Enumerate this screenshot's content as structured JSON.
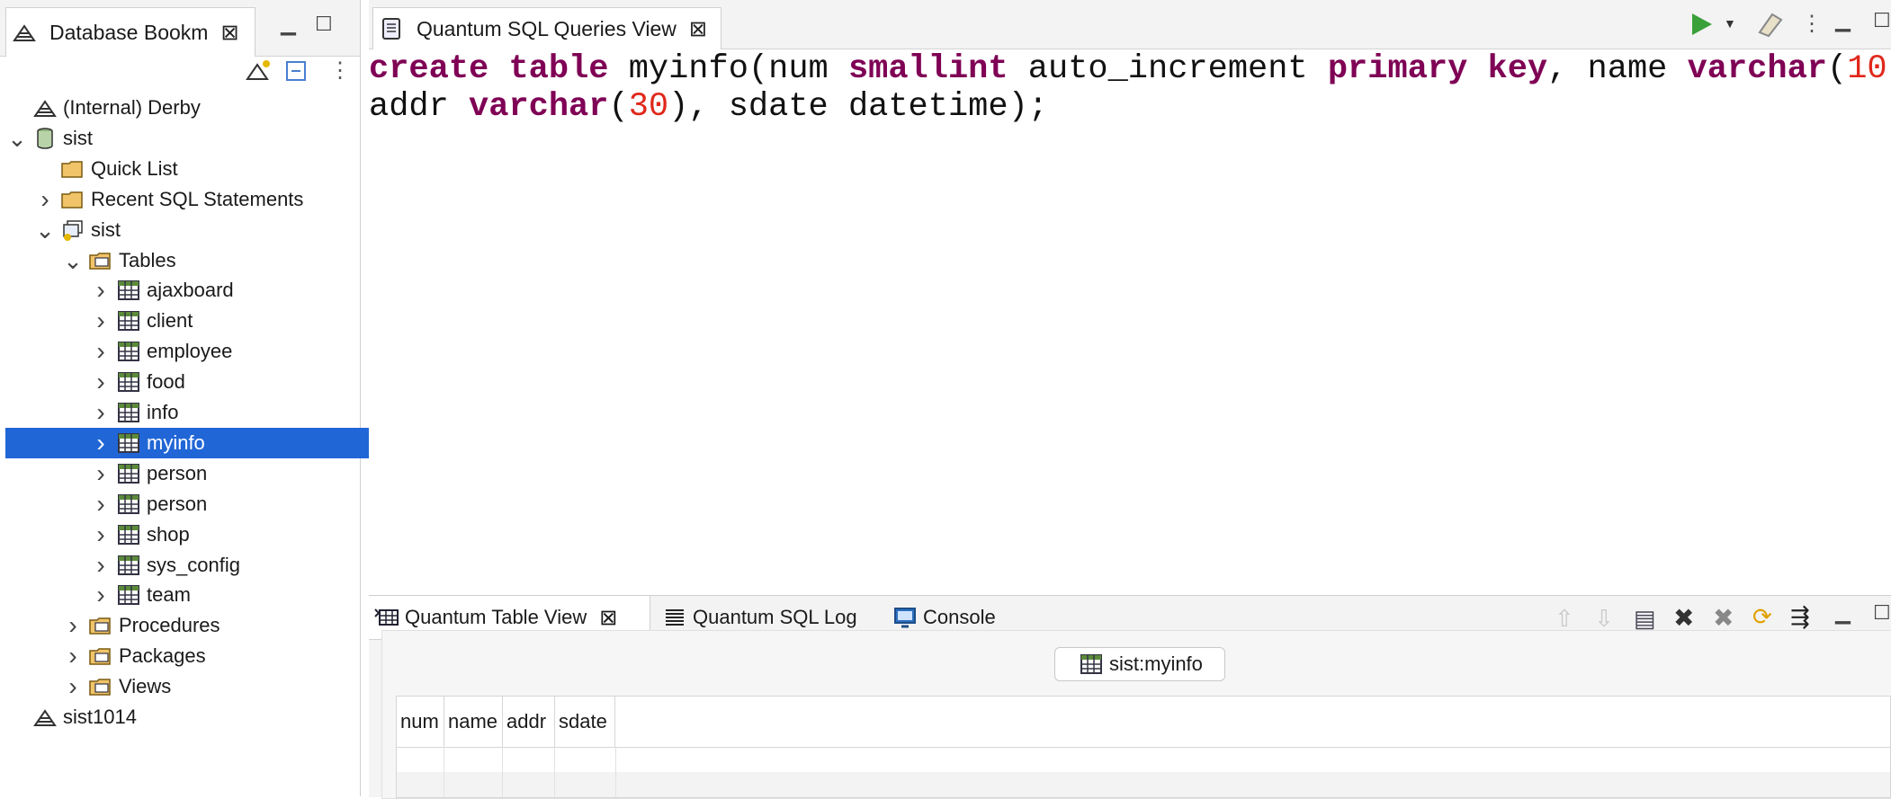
{
  "bookmarks_view": {
    "tab_title": "Database Bookm",
    "tree": [
      {
        "label": "(Internal) Derby",
        "icon": "database-bookmark-icon",
        "chevron": "",
        "indent": 0
      },
      {
        "label": "sist",
        "icon": "database-cylinder-icon",
        "chevron": "open",
        "indent": 0
      },
      {
        "label": "Quick List",
        "icon": "folder-icon",
        "chevron": "",
        "indent": 1
      },
      {
        "label": "Recent SQL Statements",
        "icon": "folder-icon",
        "chevron": "closed",
        "indent": 1
      },
      {
        "label": "sist",
        "icon": "schema-icon",
        "chevron": "open",
        "indent": 1
      },
      {
        "label": "Tables",
        "icon": "folder-tables-icon",
        "chevron": "open",
        "indent": 2
      },
      {
        "label": "ajaxboard",
        "icon": "table-icon",
        "chevron": "closed",
        "indent": 3
      },
      {
        "label": "client",
        "icon": "table-icon",
        "chevron": "closed",
        "indent": 3
      },
      {
        "label": "employee",
        "icon": "table-icon",
        "chevron": "closed",
        "indent": 3
      },
      {
        "label": "food",
        "icon": "table-icon",
        "chevron": "closed",
        "indent": 3
      },
      {
        "label": "info",
        "icon": "table-icon",
        "chevron": "closed",
        "indent": 3
      },
      {
        "label": "myinfo",
        "icon": "table-icon",
        "chevron": "closed",
        "indent": 3,
        "selected": true
      },
      {
        "label": "person",
        "icon": "table-icon",
        "chevron": "closed",
        "indent": 3
      },
      {
        "label": "person",
        "icon": "table-icon",
        "chevron": "closed",
        "indent": 3
      },
      {
        "label": "shop",
        "icon": "table-icon",
        "chevron": "closed",
        "indent": 3
      },
      {
        "label": "sys_config",
        "icon": "table-icon",
        "chevron": "closed",
        "indent": 3
      },
      {
        "label": "team",
        "icon": "table-icon",
        "chevron": "closed",
        "indent": 3
      },
      {
        "label": "Procedures",
        "icon": "folder-tables-icon",
        "chevron": "closed",
        "indent": 2
      },
      {
        "label": "Packages",
        "icon": "folder-tables-icon",
        "chevron": "closed",
        "indent": 2
      },
      {
        "label": "Views",
        "icon": "folder-tables-icon",
        "chevron": "closed",
        "indent": 2
      },
      {
        "label": "sist1014",
        "icon": "database-bookmark-icon",
        "chevron": "",
        "indent": 0
      }
    ]
  },
  "editor": {
    "tab_title": "Quantum SQL Queries View",
    "sql": {
      "t1": "create",
      "t2": " ",
      "t3": "table",
      "t4": " myinfo(num ",
      "t5": "smallint",
      "t6": " auto_increment ",
      "t7": "primary",
      "t8": " ",
      "t9": "key",
      "t10": ", name ",
      "t11": "varchar",
      "t12": "(",
      "t13": "10",
      "t14": "),",
      "l2a": "addr ",
      "l2b": "varchar",
      "l2c": "(",
      "l2d": "30",
      "l2e": "), sdate datetime);"
    }
  },
  "bottom": {
    "tabs": [
      "Quantum Table View",
      "Quantum SQL Log",
      "Console"
    ],
    "table_label": "sist:myinfo",
    "columns": [
      "num",
      "name",
      "addr",
      "sdate"
    ]
  },
  "colors": {
    "keyword": "#7f0055",
    "number": "#e0281a",
    "selection": "#2166d6"
  }
}
